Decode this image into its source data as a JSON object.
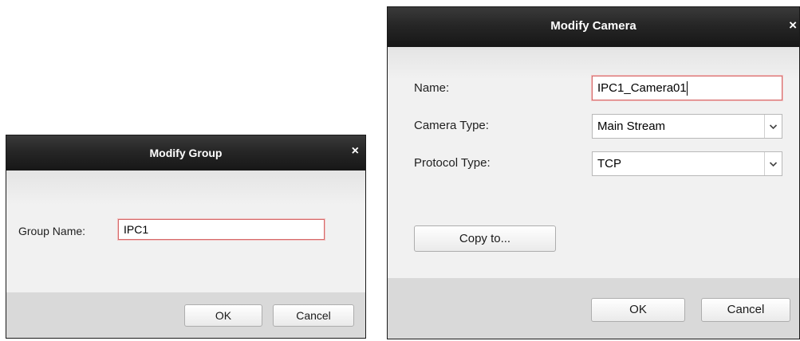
{
  "modify_group": {
    "title": "Modify Group",
    "close_glyph": "×",
    "group_name_label": "Group Name:",
    "group_name_value": "IPC1",
    "ok_label": "OK",
    "cancel_label": "Cancel"
  },
  "modify_camera": {
    "title": "Modify Camera",
    "close_glyph": "×",
    "name_label": "Name:",
    "name_value": "IPC1_Camera01",
    "camera_type_label": "Camera Type:",
    "camera_type_value": "Main Stream",
    "protocol_type_label": "Protocol Type:",
    "protocol_type_value": "TCP",
    "copy_to_label": "Copy to...",
    "ok_label": "OK",
    "cancel_label": "Cancel"
  },
  "icons": {
    "close": "close-icon",
    "dropdown": "chevron-down-icon"
  },
  "colors": {
    "titlebar": "#262626",
    "focus_border": "#d56a6a",
    "body_bg": "#f0f0f0",
    "footer_bg": "#d9d9d9"
  }
}
